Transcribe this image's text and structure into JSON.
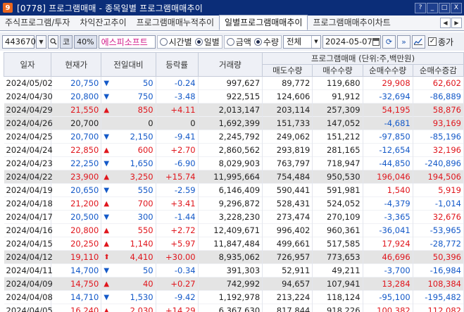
{
  "window": {
    "badge": "9",
    "title": "[0778] 프로그램매매 - 종목일별 프로그램매매추이",
    "buttons": [
      "?",
      "_",
      "□",
      "X"
    ]
  },
  "tabs": [
    {
      "label": "주식프로그램/투자",
      "active": false
    },
    {
      "label": "차익잔고추이",
      "active": false
    },
    {
      "label": "프로그램매매누적추이",
      "active": false
    },
    {
      "label": "일별프로그램매매추이",
      "active": true
    },
    {
      "label": "프로그램매매추이차트",
      "active": false
    }
  ],
  "toolbar": {
    "code": "443670",
    "market_tag": "코",
    "ratio_tag": "40%",
    "stock_name": "에스피소프트",
    "radio_period": [
      {
        "label": "시간별",
        "checked": false
      },
      {
        "label": "일별",
        "checked": true
      }
    ],
    "radio_unit": [
      {
        "label": "금액",
        "checked": false
      },
      {
        "label": "수량",
        "checked": true
      }
    ],
    "filter_select": "전체",
    "date": "2024-05-07",
    "checkbox_label": "종가",
    "checkbox_checked": true
  },
  "table": {
    "headers": {
      "date": "일자",
      "price": "현재가",
      "diff": "전일대비",
      "rate": "등락률",
      "volume": "거래량",
      "group": "프로그램매매 (단위:주,백만원)",
      "sell": "매도수량",
      "buy": "매수수량",
      "net": "순매수수량",
      "net_chg": "순매수증감"
    },
    "rows": [
      {
        "date": "2024/05/02",
        "price": "20,750",
        "dir": "down",
        "arrow": "▼",
        "diff": "50",
        "rate": "-0.24",
        "volume": "997,627",
        "sell": "89,772",
        "buy": "119,680",
        "net": "29,908",
        "net_dir": "up",
        "net_chg": "62,602",
        "chg_dir": "up",
        "sel": false
      },
      {
        "date": "2024/04/30",
        "price": "20,800",
        "dir": "down",
        "arrow": "▼",
        "diff": "750",
        "rate": "-3.48",
        "volume": "922,515",
        "sell": "124,606",
        "buy": "91,912",
        "net": "-32,694",
        "net_dir": "down",
        "net_chg": "-86,889",
        "chg_dir": "down",
        "sel": false
      },
      {
        "date": "2024/04/29",
        "price": "21,550",
        "dir": "up",
        "arrow": "▲",
        "diff": "850",
        "rate": "+4.11",
        "volume": "2,013,147",
        "sell": "203,114",
        "buy": "257,309",
        "net": "54,195",
        "net_dir": "up",
        "net_chg": "58,876",
        "chg_dir": "up",
        "sel": true
      },
      {
        "date": "2024/04/26",
        "price": "20,700",
        "dir": "flat",
        "arrow": "",
        "diff": "0",
        "rate": "0",
        "volume": "1,692,399",
        "sell": "151,733",
        "buy": "147,052",
        "net": "-4,681",
        "net_dir": "down",
        "net_chg": "93,169",
        "chg_dir": "up",
        "sel": true
      },
      {
        "date": "2024/04/25",
        "price": "20,700",
        "dir": "down",
        "arrow": "▼",
        "diff": "2,150",
        "rate": "-9.41",
        "volume": "2,245,792",
        "sell": "249,062",
        "buy": "151,212",
        "net": "-97,850",
        "net_dir": "down",
        "net_chg": "-85,196",
        "chg_dir": "down",
        "sel": false
      },
      {
        "date": "2024/04/24",
        "price": "22,850",
        "dir": "up",
        "arrow": "▲",
        "diff": "600",
        "rate": "+2.70",
        "volume": "2,860,562",
        "sell": "293,819",
        "buy": "281,165",
        "net": "-12,654",
        "net_dir": "down",
        "net_chg": "32,196",
        "chg_dir": "up",
        "sel": false
      },
      {
        "date": "2024/04/23",
        "price": "22,250",
        "dir": "down",
        "arrow": "▼",
        "diff": "1,650",
        "rate": "-6.90",
        "volume": "8,029,903",
        "sell": "763,797",
        "buy": "718,947",
        "net": "-44,850",
        "net_dir": "down",
        "net_chg": "-240,896",
        "chg_dir": "down",
        "sel": false
      },
      {
        "date": "2024/04/22",
        "price": "23,900",
        "dir": "up",
        "arrow": "▲",
        "diff": "3,250",
        "rate": "+15.74",
        "volume": "11,995,664",
        "sell": "754,484",
        "buy": "950,530",
        "net": "196,046",
        "net_dir": "up",
        "net_chg": "194,506",
        "chg_dir": "up",
        "sel": true
      },
      {
        "date": "2024/04/19",
        "price": "20,650",
        "dir": "down",
        "arrow": "▼",
        "diff": "550",
        "rate": "-2.59",
        "volume": "6,146,409",
        "sell": "590,441",
        "buy": "591,981",
        "net": "1,540",
        "net_dir": "up",
        "net_chg": "5,919",
        "chg_dir": "up",
        "sel": false
      },
      {
        "date": "2024/04/18",
        "price": "21,200",
        "dir": "up",
        "arrow": "▲",
        "diff": "700",
        "rate": "+3.41",
        "volume": "9,296,872",
        "sell": "528,431",
        "buy": "524,052",
        "net": "-4,379",
        "net_dir": "down",
        "net_chg": "-1,014",
        "chg_dir": "down",
        "sel": false
      },
      {
        "date": "2024/04/17",
        "price": "20,500",
        "dir": "down",
        "arrow": "▼",
        "diff": "300",
        "rate": "-1.44",
        "volume": "3,228,230",
        "sell": "273,474",
        "buy": "270,109",
        "net": "-3,365",
        "net_dir": "down",
        "net_chg": "32,676",
        "chg_dir": "up",
        "sel": false
      },
      {
        "date": "2024/04/16",
        "price": "20,800",
        "dir": "up",
        "arrow": "▲",
        "diff": "550",
        "rate": "+2.72",
        "volume": "12,409,671",
        "sell": "996,402",
        "buy": "960,361",
        "net": "-36,041",
        "net_dir": "down",
        "net_chg": "-53,965",
        "chg_dir": "down",
        "sel": false
      },
      {
        "date": "2024/04/15",
        "price": "20,250",
        "dir": "up",
        "arrow": "▲",
        "diff": "1,140",
        "rate": "+5.97",
        "volume": "11,847,484",
        "sell": "499,661",
        "buy": "517,585",
        "net": "17,924",
        "net_dir": "up",
        "net_chg": "-28,772",
        "chg_dir": "down",
        "sel": false
      },
      {
        "date": "2024/04/12",
        "price": "19,110",
        "dir": "up",
        "arrow": "⬆",
        "diff": "4,410",
        "rate": "+30.00",
        "volume": "8,935,062",
        "sell": "726,957",
        "buy": "773,653",
        "net": "46,696",
        "net_dir": "up",
        "net_chg": "50,396",
        "chg_dir": "up",
        "sel": true
      },
      {
        "date": "2024/04/11",
        "price": "14,700",
        "dir": "down",
        "arrow": "▼",
        "diff": "50",
        "rate": "-0.34",
        "volume": "391,303",
        "sell": "52,911",
        "buy": "49,211",
        "net": "-3,700",
        "net_dir": "down",
        "net_chg": "-16,984",
        "chg_dir": "down",
        "sel": false
      },
      {
        "date": "2024/04/09",
        "price": "14,750",
        "dir": "up",
        "arrow": "▲",
        "diff": "40",
        "rate": "+0.27",
        "volume": "742,992",
        "sell": "94,657",
        "buy": "107,941",
        "net": "13,284",
        "net_dir": "up",
        "net_chg": "108,384",
        "chg_dir": "up",
        "sel": true
      },
      {
        "date": "2024/04/08",
        "price": "14,710",
        "dir": "down",
        "arrow": "▼",
        "diff": "1,530",
        "rate": "-9.42",
        "volume": "1,192,978",
        "sell": "213,224",
        "buy": "118,124",
        "net": "-95,100",
        "net_dir": "down",
        "net_chg": "-195,482",
        "chg_dir": "down",
        "sel": false
      },
      {
        "date": "2024/04/05",
        "price": "16,240",
        "dir": "up",
        "arrow": "▲",
        "diff": "2,030",
        "rate": "+14.29",
        "volume": "6,367,630",
        "sell": "817,844",
        "buy": "918,226",
        "net": "100,382",
        "net_dir": "up",
        "net_chg": "112,082",
        "chg_dir": "up",
        "sel": false
      }
    ]
  }
}
